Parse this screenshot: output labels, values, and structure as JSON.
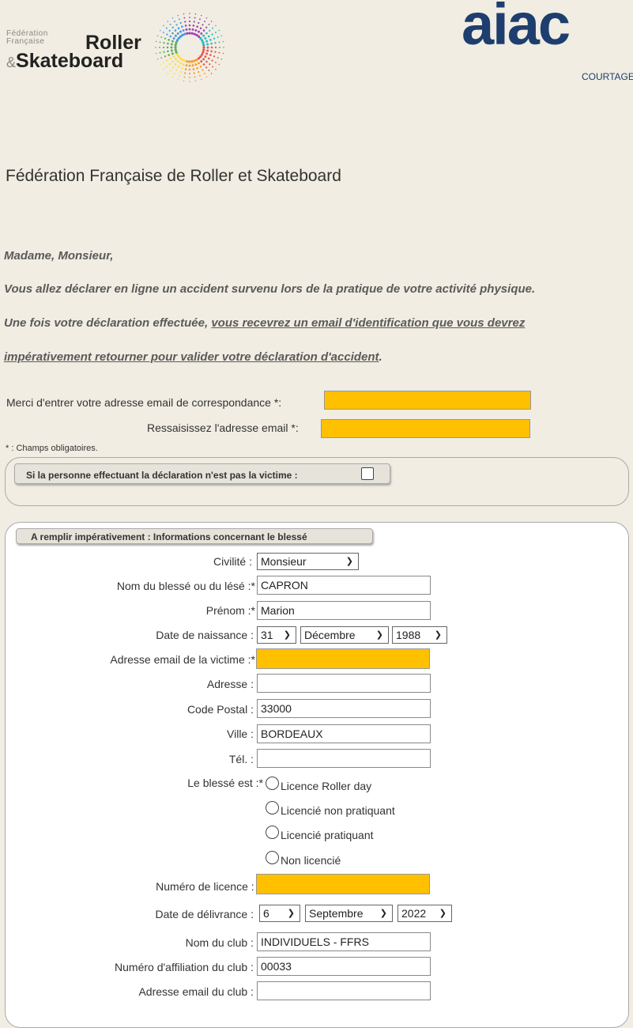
{
  "header": {
    "ffrs_logo": {
      "line1": "Fédération",
      "line2": "Française",
      "roller": "Roller",
      "amp": "&",
      "skate": "Skateboard"
    },
    "aiac_logo": {
      "word": "aiac",
      "sub": "COURTAGE"
    }
  },
  "title": "Fédération Française de Roller et Skateboard",
  "intro": {
    "greeting": "Madame, Monsieur,",
    "line1": "Vous allez déclarer en ligne un accident survenu lors de la pratique de votre activité physique.",
    "line2_plain": "Une fois votre déclaration effectuée, ",
    "line2_link": "vous recevrez un email d'identification que vous devrez",
    "line3_link": "impérativement retourner pour valider votre déclaration d'accident",
    "line3_end": "."
  },
  "email_section": {
    "email_label": "Merci d'entrer votre adresse email de correspondance *:",
    "email_value": "",
    "confirm_label": "Ressaisissez l'adresse email *:",
    "confirm_value": "",
    "required_note": "* : Champs obligatoires."
  },
  "declarant_box": {
    "label": "Si la personne effectuant la déclaration n'est pas la victime :",
    "checked": false
  },
  "victim_box": {
    "title": "A remplir impérativement : Informations concernant le blessé",
    "civilite_label": "Civilité :",
    "civilite_value": "Monsieur",
    "nom_label": "Nom du blessé ou du lésé :*",
    "nom_value": "CAPRON",
    "prenom_label": "Prénom :*",
    "prenom_value": "Marion",
    "naissance_label": "Date de naissance :",
    "naissance_jour": "31",
    "naissance_mois": "Décembre",
    "naissance_annee": "1988",
    "email_label": "Adresse email de la victime :*",
    "adresse_label": "Adresse :",
    "adresse_value": "",
    "cp_label": "Code Postal :",
    "cp_value": "33000",
    "ville_label": "Ville :",
    "ville_value": "BORDEAUX",
    "tel_label": "Tél. :",
    "tel_value": "",
    "statut_label": "Le blessé est :*",
    "statut_options": [
      "Licence Roller day",
      "Licencié non pratiquant",
      "Licencié pratiquant",
      "Non licencié"
    ],
    "licence_label": "Numéro de licence : *",
    "delivrance_label": "Date de délivrance :",
    "delivrance_jour": "6",
    "delivrance_mois": "Septembre",
    "delivrance_annee": "2022",
    "club_label": "Nom du club :",
    "club_value": "INDIVIDUELS - FFRS",
    "affiliation_label": "Numéro d'affiliation du club :",
    "affiliation_value": "00033",
    "club_email_label": "Adresse email du club :",
    "club_email_value": ""
  },
  "colors": {
    "background": "#f1ede2",
    "highlight": "#ffc000",
    "aiac_blue": "#1d3e6e"
  }
}
